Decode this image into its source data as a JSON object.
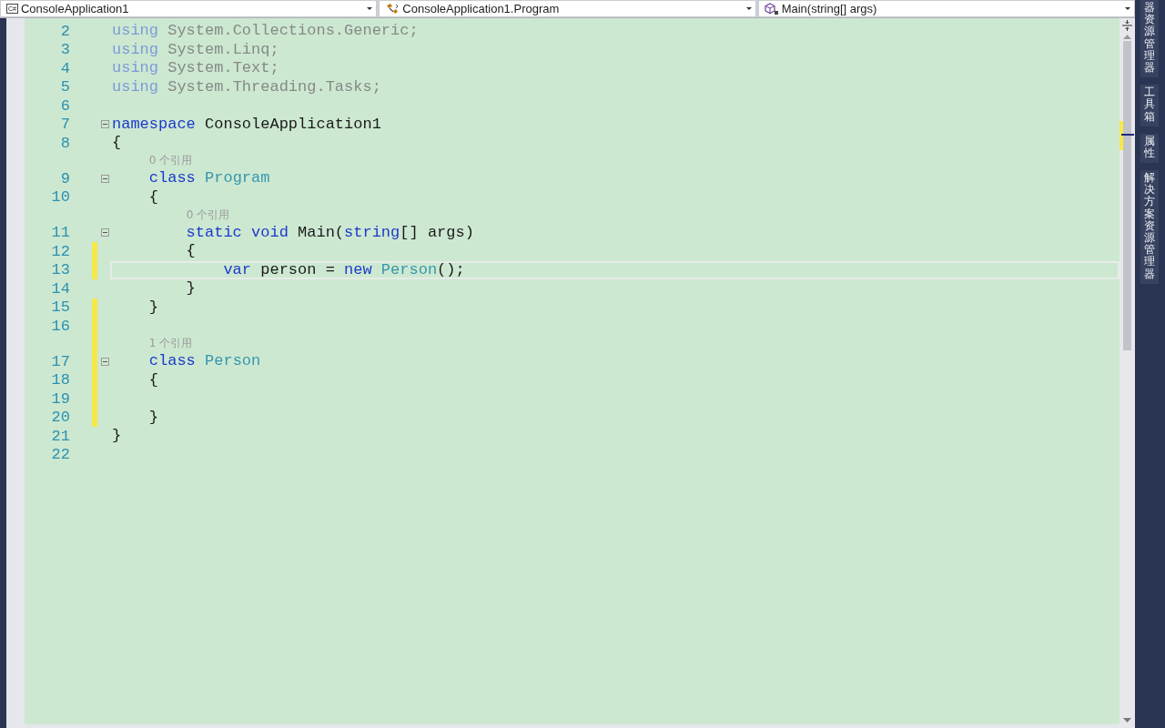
{
  "navigation_bar": {
    "dropdowns": [
      {
        "kind": "project",
        "icon_text": "C#",
        "text": "ConsoleApplication1"
      },
      {
        "kind": "class",
        "text": "ConsoleApplication1.Program"
      },
      {
        "kind": "method",
        "text": "Main(string[] args)"
      }
    ]
  },
  "editor": {
    "lines": [
      {
        "kind": "code",
        "number": "2",
        "changed": false,
        "current": false,
        "tokens": [
          {
            "text": "using",
            "kind": "faded-keyword"
          },
          {
            "text": " System.Collections.Generic;",
            "kind": "faded"
          }
        ]
      },
      {
        "kind": "code",
        "number": "3",
        "changed": false,
        "current": false,
        "tokens": [
          {
            "text": "using",
            "kind": "faded-keyword"
          },
          {
            "text": " System.Linq;",
            "kind": "faded"
          }
        ]
      },
      {
        "kind": "code",
        "number": "4",
        "changed": false,
        "current": false,
        "tokens": [
          {
            "text": "using",
            "kind": "faded-keyword"
          },
          {
            "text": " System.Text;",
            "kind": "faded"
          }
        ]
      },
      {
        "kind": "code",
        "number": "5",
        "changed": false,
        "current": false,
        "tokens": [
          {
            "text": "using",
            "kind": "faded-keyword"
          },
          {
            "text": " System.Threading.Tasks;",
            "kind": "faded"
          }
        ]
      },
      {
        "kind": "code",
        "number": "6",
        "changed": false,
        "current": false
      },
      {
        "kind": "code",
        "number": "7",
        "changed": false,
        "current": false,
        "expanded": true,
        "tokens": [
          {
            "text": "namespace",
            "kind": "keyword"
          },
          {
            "text": " ConsoleApplication1",
            "kind": "plain"
          }
        ]
      },
      {
        "kind": "code",
        "number": "8",
        "changed": false,
        "current": false,
        "tokens": [
          {
            "text": "{",
            "kind": "plain"
          }
        ]
      },
      {
        "kind": "codelens",
        "changed": false,
        "text": "    0 个引用"
      },
      {
        "kind": "code",
        "number": "9",
        "changed": false,
        "current": false,
        "expanded": true,
        "tokens": [
          {
            "text": "    class",
            "kind": "keyword"
          },
          {
            "text": " Program",
            "kind": "type"
          }
        ]
      },
      {
        "kind": "code",
        "number": "10",
        "changed": false,
        "current": false,
        "tokens": [
          {
            "text": "    {",
            "kind": "plain"
          }
        ]
      },
      {
        "kind": "codelens",
        "changed": false,
        "text": "        0 个引用"
      },
      {
        "kind": "code",
        "number": "11",
        "changed": false,
        "current": false,
        "expanded": true,
        "tokens": [
          {
            "text": "        static",
            "kind": "keyword"
          },
          {
            "text": " void",
            "kind": "keyword"
          },
          {
            "text": " Main(",
            "kind": "plain"
          },
          {
            "text": "string",
            "kind": "keyword"
          },
          {
            "text": "[] args)",
            "kind": "plain"
          }
        ]
      },
      {
        "kind": "code",
        "number": "12",
        "changed": true,
        "current": false,
        "tokens": [
          {
            "text": "        {",
            "kind": "plain"
          }
        ]
      },
      {
        "kind": "code",
        "number": "13",
        "changed": true,
        "current": true,
        "tokens": [
          {
            "text": "            var",
            "kind": "keyword"
          },
          {
            "text": " person = ",
            "kind": "plain"
          },
          {
            "text": "new",
            "kind": "keyword"
          },
          {
            "text": " Person",
            "kind": "type"
          },
          {
            "text": "();",
            "kind": "plain"
          }
        ]
      },
      {
        "kind": "code",
        "number": "14",
        "changed": false,
        "current": false,
        "tokens": [
          {
            "text": "        }",
            "kind": "plain"
          }
        ]
      },
      {
        "kind": "code",
        "number": "15",
        "changed": true,
        "current": false,
        "tokens": [
          {
            "text": "    }",
            "kind": "plain"
          }
        ]
      },
      {
        "kind": "code",
        "number": "16",
        "changed": true,
        "current": false
      },
      {
        "kind": "codelens",
        "changed": true,
        "text": "    1 个引用"
      },
      {
        "kind": "code",
        "number": "17",
        "changed": true,
        "current": false,
        "expanded": true,
        "tokens": [
          {
            "text": "    class",
            "kind": "keyword"
          },
          {
            "text": " Person",
            "kind": "type"
          }
        ]
      },
      {
        "kind": "code",
        "number": "18",
        "changed": true,
        "current": false,
        "tokens": [
          {
            "text": "    {",
            "kind": "plain"
          }
        ]
      },
      {
        "kind": "code",
        "number": "19",
        "changed": true,
        "current": false
      },
      {
        "kind": "code",
        "number": "20",
        "changed": true,
        "current": false,
        "tokens": [
          {
            "text": "    }",
            "kind": "plain"
          }
        ]
      },
      {
        "kind": "code",
        "number": "21",
        "changed": false,
        "current": false,
        "tokens": [
          {
            "text": "}",
            "kind": "plain"
          }
        ]
      },
      {
        "kind": "code",
        "number": "22",
        "changed": false,
        "current": false
      }
    ]
  },
  "side_panel": {
    "tabs": [
      {
        "label": "器资源管理器"
      },
      {
        "label": "工具箱"
      },
      {
        "label": "属性"
      },
      {
        "label": "解决方案资源管理器"
      }
    ]
  }
}
